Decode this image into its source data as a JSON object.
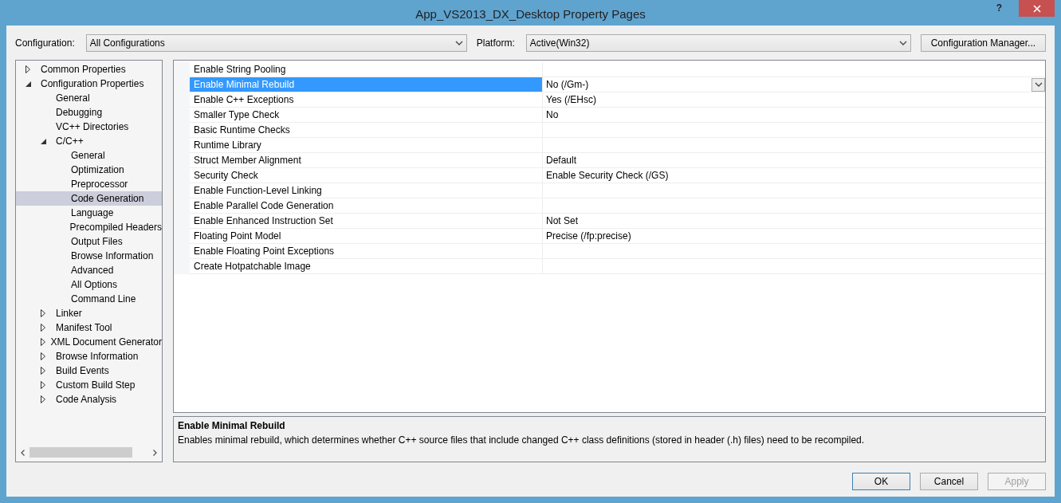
{
  "window": {
    "title": "App_VS2013_DX_Desktop Property Pages",
    "help": "?"
  },
  "configuration": {
    "label": "Configuration:",
    "value": "All Configurations"
  },
  "platform": {
    "label": "Platform:",
    "value": "Active(Win32)"
  },
  "manager_button": "Configuration Manager...",
  "tree": [
    {
      "label": "Common Properties",
      "expanded": false,
      "selected": false
    },
    {
      "label": "Configuration Properties",
      "expanded": true,
      "selected": false,
      "children": [
        {
          "label": "General",
          "selected": false
        },
        {
          "label": "Debugging",
          "selected": false
        },
        {
          "label": "VC++ Directories",
          "selected": false
        },
        {
          "label": "C/C++",
          "expanded": true,
          "selected": false,
          "children": [
            {
              "label": "General",
              "selected": false
            },
            {
              "label": "Optimization",
              "selected": false
            },
            {
              "label": "Preprocessor",
              "selected": false
            },
            {
              "label": "Code Generation",
              "selected": true
            },
            {
              "label": "Language",
              "selected": false
            },
            {
              "label": "Precompiled Headers",
              "selected": false
            },
            {
              "label": "Output Files",
              "selected": false
            },
            {
              "label": "Browse Information",
              "selected": false
            },
            {
              "label": "Advanced",
              "selected": false
            },
            {
              "label": "All Options",
              "selected": false
            },
            {
              "label": "Command Line",
              "selected": false
            }
          ]
        },
        {
          "label": "Linker",
          "expanded": false,
          "selected": false
        },
        {
          "label": "Manifest Tool",
          "expanded": false,
          "selected": false
        },
        {
          "label": "XML Document Generator",
          "expanded": false,
          "selected": false
        },
        {
          "label": "Browse Information",
          "expanded": false,
          "selected": false
        },
        {
          "label": "Build Events",
          "expanded": false,
          "selected": false
        },
        {
          "label": "Custom Build Step",
          "expanded": false,
          "selected": false
        },
        {
          "label": "Code Analysis",
          "expanded": false,
          "selected": false
        }
      ]
    }
  ],
  "properties": [
    {
      "name": "Enable String Pooling",
      "selected": false
    },
    {
      "name": "Enable Minimal Rebuild",
      "value": "No (/Gm-)",
      "selected": true
    },
    {
      "name": "Enable C++ Exceptions",
      "value": "Yes (/EHsc)",
      "selected": false
    },
    {
      "name": "Smaller Type Check",
      "value": "No",
      "selected": false
    },
    {
      "name": "Basic Runtime Checks",
      "selected": false
    },
    {
      "name": "Runtime Library",
      "selected": false
    },
    {
      "name": "Struct Member Alignment",
      "value": "Default",
      "selected": false
    },
    {
      "name": "Security Check",
      "value": "Enable Security Check (/GS)",
      "selected": false
    },
    {
      "name": "Enable Function-Level Linking",
      "selected": false
    },
    {
      "name": "Enable Parallel Code Generation",
      "selected": false
    },
    {
      "name": "Enable Enhanced Instruction Set",
      "value": "Not Set",
      "selected": false
    },
    {
      "name": "Floating Point Model",
      "value": "Precise (/fp:precise)",
      "selected": false
    },
    {
      "name": "Enable Floating Point Exceptions",
      "selected": false
    },
    {
      "name": "Create Hotpatchable Image",
      "selected": false
    }
  ],
  "description": {
    "title": "Enable Minimal Rebuild",
    "text": "Enables minimal rebuild, which determines whether C++ source files that include changed C++ class definitions (stored in header (.h) files) need to be recompiled."
  },
  "buttons": [
    {
      "label": "OK",
      "default": true,
      "disabled": false
    },
    {
      "label": "Cancel",
      "default": false,
      "disabled": false
    },
    {
      "label": "Apply",
      "default": false,
      "disabled": true
    }
  ]
}
